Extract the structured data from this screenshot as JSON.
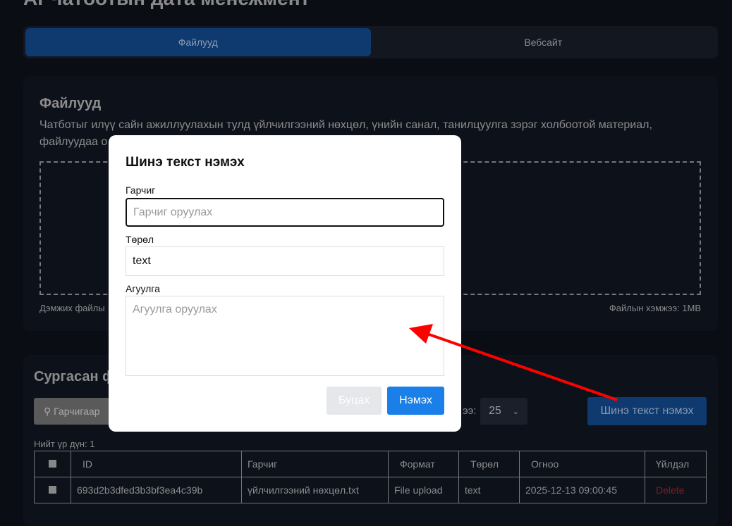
{
  "header": {
    "title": "AI Чатботын дата менежмент"
  },
  "tabs": [
    {
      "label": "Файлууд"
    },
    {
      "label": "Вебсайт"
    }
  ],
  "files_card": {
    "title": "Файлууд",
    "description": "Чатботыг илүү сайн ажиллуулахын тулд үйлчилгээний нөхцөл, үнийн санал, танилцуулга зэрэг холбоотой материал, файлуудаа о",
    "supported": "Дэмжих файлы",
    "size": "Файлын хэмжээ: 1MB"
  },
  "trained": {
    "title": "Сургасан ф",
    "search_placeholder": "Гарчигаар",
    "page_size_label": "ээ:",
    "page_size": "25",
    "new_button": "Шинэ текст нэмэх",
    "total": "Нийт үр дүн: 1",
    "columns": [
      "ID",
      "Гарчиг",
      "Формат",
      "Төрөл",
      "Огноо",
      "Үйлдэл"
    ],
    "rows": [
      {
        "id": "693d2b3dfed3b3bf3ea4c39b",
        "title": "үйлчилгээний нөхцөл.txt",
        "format": "File upload",
        "type": "text",
        "date": "2025-12-13 09:00:45",
        "action": "Delete"
      }
    ]
  },
  "modal": {
    "title": "Шинэ текст нэмэх",
    "title_label": "Гарчиг",
    "title_placeholder": "Гарчиг оруулах",
    "type_label": "Төрөл",
    "type_value": "text",
    "content_label": "Агуулга",
    "content_placeholder": "Агуулга оруулах",
    "cancel": "Буцах",
    "submit": "Нэмэх"
  },
  "colors": {
    "accent": "#1a7fe8",
    "annotation": "#ff0000"
  }
}
